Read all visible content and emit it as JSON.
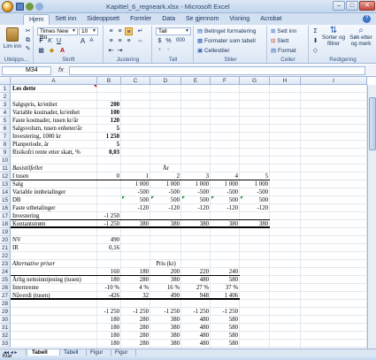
{
  "window": {
    "title": "Kapittel_6_regneark.xlsx - Microsoft Excel",
    "min": "–",
    "max": "□",
    "close": "✕"
  },
  "tabs": [
    "Hjem",
    "Sett inn",
    "Sideoppsett",
    "Formler",
    "Data",
    "Se gjennom",
    "Visning",
    "Acrobat"
  ],
  "ribbon": {
    "clipboard": {
      "paste": "Lim inn",
      "label": "Utklipps..."
    },
    "font": {
      "name": "Times New Ro",
      "size": "10",
      "bold": "F",
      "italic": "K",
      "underline": "U",
      "grow": "A",
      "shrink": "A",
      "label": "Skrift"
    },
    "alignment": {
      "label": "Justering"
    },
    "number": {
      "format": "Tall",
      "currency": "%",
      "pct": "000",
      "label": "Tall"
    },
    "styles": {
      "cond": "Betinget formatering",
      "table": "Formater som tabell",
      "cell": "Cellestiler",
      "label": "Stiler"
    },
    "cells": {
      "insert": "Sett inn",
      "delete": "Slett",
      "format": "Format",
      "label": "Celler"
    },
    "editing": {
      "sigma": "Σ",
      "sort": "Sorter og filtrer",
      "find": "Søk etter og merk",
      "label": "Redigering"
    }
  },
  "formula_bar": {
    "name_box": "M34",
    "fx": "fx",
    "value": ""
  },
  "columns": [
    "A",
    "B",
    "C",
    "D",
    "E",
    "F",
    "G",
    "H",
    "I"
  ],
  "rows": [
    {
      "n": "1",
      "cells": [
        {
          "col": "A",
          "v": "Les dette",
          "b": true
        }
      ]
    },
    {
      "n": "2",
      "cells": []
    },
    {
      "n": "3",
      "cells": [
        {
          "col": "A",
          "v": "Salgspris, kr/enhet"
        },
        {
          "col": "B",
          "v": "200",
          "b": true,
          "r": true
        }
      ]
    },
    {
      "n": "4",
      "cells": [
        {
          "col": "A",
          "v": "Variable kostnader, kr/enhet"
        },
        {
          "col": "B",
          "v": "100",
          "b": true,
          "r": true
        }
      ]
    },
    {
      "n": "5",
      "cells": [
        {
          "col": "A",
          "v": "Faste kostnader, tusen kr/år"
        },
        {
          "col": "B",
          "v": "120",
          "b": true,
          "r": true
        }
      ]
    },
    {
      "n": "6",
      "cells": [
        {
          "col": "A",
          "v": "Salgsvolum, tusen enheter/år"
        },
        {
          "col": "B",
          "v": "5",
          "b": true,
          "r": true
        }
      ]
    },
    {
      "n": "7",
      "cells": [
        {
          "col": "A",
          "v": "Investering, 1000 kr"
        },
        {
          "col": "B",
          "v": "1 250",
          "b": true,
          "r": true
        }
      ]
    },
    {
      "n": "8",
      "cells": [
        {
          "col": "A",
          "v": "Planperiode, år"
        },
        {
          "col": "B",
          "v": "5",
          "b": true,
          "r": true
        }
      ]
    },
    {
      "n": "9",
      "cells": [
        {
          "col": "A",
          "v": "Risikofri rente etter skatt, %"
        },
        {
          "col": "B",
          "v": "0,03",
          "b": true,
          "r": true
        }
      ]
    },
    {
      "n": "10",
      "cells": []
    },
    {
      "n": "11",
      "cells": [
        {
          "col": "A",
          "v": "Basistilfellet",
          "i": true
        },
        {
          "col": "D",
          "v": "År",
          "c": true
        }
      ]
    },
    {
      "n": "12",
      "cells": [
        {
          "col": "A",
          "v": "I tusen",
          "ul": true
        },
        {
          "col": "B",
          "v": "0",
          "r": true,
          "ul": true
        },
        {
          "col": "C",
          "v": "1",
          "r": true,
          "ul": true
        },
        {
          "col": "D",
          "v": "2",
          "r": true,
          "ul": true
        },
        {
          "col": "E",
          "v": "3",
          "r": true,
          "ul": true
        },
        {
          "col": "F",
          "v": "4",
          "r": true,
          "ul": true
        },
        {
          "col": "G",
          "v": "5",
          "r": true,
          "ul": true
        }
      ]
    },
    {
      "n": "13",
      "cells": [
        {
          "col": "A",
          "v": "Salg"
        },
        {
          "col": "C",
          "v": "1 000",
          "r": true
        },
        {
          "col": "D",
          "v": "1 000",
          "r": true
        },
        {
          "col": "E",
          "v": "1 000",
          "r": true
        },
        {
          "col": "F",
          "v": "1 000",
          "r": true
        },
        {
          "col": "G",
          "v": "1 000",
          "r": true
        }
      ]
    },
    {
      "n": "14",
      "cells": [
        {
          "col": "A",
          "v": "Variable innbetalinger"
        },
        {
          "col": "C",
          "v": "-500",
          "r": true
        },
        {
          "col": "D",
          "v": "-500",
          "r": true
        },
        {
          "col": "E",
          "v": "-500",
          "r": true
        },
        {
          "col": "F",
          "v": "-500",
          "r": true
        },
        {
          "col": "G",
          "v": "-500",
          "r": true
        }
      ]
    },
    {
      "n": "15",
      "cells": [
        {
          "col": "A",
          "v": "DB"
        },
        {
          "col": "C",
          "v": "500",
          "r": true
        },
        {
          "col": "D",
          "v": "500",
          "r": true
        },
        {
          "col": "E",
          "v": "500",
          "r": true
        },
        {
          "col": "F",
          "v": "500",
          "r": true
        },
        {
          "col": "G",
          "v": "500",
          "r": true
        }
      ]
    },
    {
      "n": "16",
      "cells": [
        {
          "col": "A",
          "v": "Faste utbetalinger"
        },
        {
          "col": "C",
          "v": "-120",
          "r": true
        },
        {
          "col": "D",
          "v": "-120",
          "r": true
        },
        {
          "col": "E",
          "v": "-120",
          "r": true
        },
        {
          "col": "F",
          "v": "-120",
          "r": true
        },
        {
          "col": "G",
          "v": "-120",
          "r": true
        }
      ]
    },
    {
      "n": "17",
      "cells": [
        {
          "col": "A",
          "v": "Investering",
          "ul": true
        },
        {
          "col": "B",
          "v": "-1 250",
          "r": true,
          "ul": true
        },
        {
          "col": "C",
          "v": "",
          "ul": true
        },
        {
          "col": "D",
          "v": "",
          "ul": true
        },
        {
          "col": "E",
          "v": "",
          "ul": true
        },
        {
          "col": "F",
          "v": "",
          "ul": true
        },
        {
          "col": "G",
          "v": "",
          "ul": true
        }
      ]
    },
    {
      "n": "18",
      "cells": [
        {
          "col": "A",
          "v": "Kontantstrøm",
          "dbl": true
        },
        {
          "col": "B",
          "v": "-1 250",
          "r": true,
          "dbl": true
        },
        {
          "col": "C",
          "v": "380",
          "r": true,
          "dbl": true
        },
        {
          "col": "D",
          "v": "380",
          "r": true,
          "dbl": true
        },
        {
          "col": "E",
          "v": "380",
          "r": true,
          "dbl": true
        },
        {
          "col": "F",
          "v": "380",
          "r": true,
          "dbl": true
        },
        {
          "col": "G",
          "v": "380",
          "r": true,
          "dbl": true
        }
      ]
    },
    {
      "n": "19",
      "cells": []
    },
    {
      "n": "20",
      "cells": [
        {
          "col": "A",
          "v": "NV"
        },
        {
          "col": "B",
          "v": "490",
          "r": true
        }
      ]
    },
    {
      "n": "21",
      "cells": [
        {
          "col": "A",
          "v": "IR"
        },
        {
          "col": "B",
          "v": "0,16",
          "r": true
        }
      ]
    },
    {
      "n": "22",
      "cells": []
    },
    {
      "n": "23",
      "cells": [
        {
          "col": "A",
          "v": "Alternative priser",
          "i": true
        },
        {
          "col": "D",
          "v": "Pris (kr)",
          "c": true
        }
      ]
    },
    {
      "n": "24",
      "cells": [
        {
          "col": "B",
          "v": "160",
          "r": true,
          "ul": true
        },
        {
          "col": "C",
          "v": "180",
          "r": true,
          "ul": true
        },
        {
          "col": "D",
          "v": "200",
          "r": true,
          "ul": true
        },
        {
          "col": "E",
          "v": "220",
          "r": true,
          "ul": true
        },
        {
          "col": "F",
          "v": "240",
          "r": true,
          "ul": true
        },
        {
          "col": "A",
          "v": "",
          "ul": true
        }
      ]
    },
    {
      "n": "25",
      "cells": [
        {
          "col": "A",
          "v": "Årlig nettoinntjening (tusen)"
        },
        {
          "col": "B",
          "v": "180",
          "r": true
        },
        {
          "col": "C",
          "v": "280",
          "r": true
        },
        {
          "col": "D",
          "v": "380",
          "r": true
        },
        {
          "col": "E",
          "v": "480",
          "r": true
        },
        {
          "col": "F",
          "v": "580",
          "r": true
        }
      ]
    },
    {
      "n": "26",
      "cells": [
        {
          "col": "A",
          "v": "Internrente"
        },
        {
          "col": "B",
          "v": "-10 %",
          "r": true
        },
        {
          "col": "C",
          "v": "4 %",
          "r": true
        },
        {
          "col": "D",
          "v": "16 %",
          "r": true
        },
        {
          "col": "E",
          "v": "27 %",
          "r": true
        },
        {
          "col": "F",
          "v": "37 %",
          "r": true
        }
      ]
    },
    {
      "n": "27",
      "cells": [
        {
          "col": "A",
          "v": "Nåverdi (tusen)",
          "dbl": true
        },
        {
          "col": "B",
          "v": "-426",
          "r": true,
          "dbl": true
        },
        {
          "col": "C",
          "v": "32",
          "r": true,
          "dbl": true
        },
        {
          "col": "D",
          "v": "490",
          "r": true,
          "dbl": true
        },
        {
          "col": "E",
          "v": "948",
          "r": true,
          "dbl": true
        },
        {
          "col": "F",
          "v": "1 406",
          "r": true,
          "dbl": true
        }
      ]
    },
    {
      "n": "28",
      "cells": []
    },
    {
      "n": "29",
      "cells": [
        {
          "col": "B",
          "v": "-1 250",
          "r": true
        },
        {
          "col": "C",
          "v": "-1 250",
          "r": true
        },
        {
          "col": "D",
          "v": "-1 250",
          "r": true
        },
        {
          "col": "E",
          "v": "-1 250",
          "r": true
        },
        {
          "col": "F",
          "v": "-1 250",
          "r": true
        }
      ]
    },
    {
      "n": "30",
      "cells": [
        {
          "col": "B",
          "v": "180",
          "r": true
        },
        {
          "col": "C",
          "v": "280",
          "r": true
        },
        {
          "col": "D",
          "v": "380",
          "r": true
        },
        {
          "col": "E",
          "v": "480",
          "r": true
        },
        {
          "col": "F",
          "v": "580",
          "r": true
        }
      ]
    },
    {
      "n": "31",
      "cells": [
        {
          "col": "B",
          "v": "180",
          "r": true
        },
        {
          "col": "C",
          "v": "280",
          "r": true
        },
        {
          "col": "D",
          "v": "380",
          "r": true
        },
        {
          "col": "E",
          "v": "480",
          "r": true
        },
        {
          "col": "F",
          "v": "580",
          "r": true
        }
      ]
    },
    {
      "n": "32",
      "cells": [
        {
          "col": "B",
          "v": "180",
          "r": true
        },
        {
          "col": "C",
          "v": "280",
          "r": true
        },
        {
          "col": "D",
          "v": "380",
          "r": true
        },
        {
          "col": "E",
          "v": "480",
          "r": true
        },
        {
          "col": "F",
          "v": "580",
          "r": true
        }
      ]
    },
    {
      "n": "33",
      "cells": [
        {
          "col": "B",
          "v": "180",
          "r": true
        },
        {
          "col": "C",
          "v": "280",
          "r": true
        },
        {
          "col": "D",
          "v": "380",
          "r": true
        },
        {
          "col": "E",
          "v": "480",
          "r": true
        },
        {
          "col": "F",
          "v": "580",
          "r": true
        }
      ]
    }
  ],
  "sheets": [
    "Tabell 6.2",
    "Tabell 6.3",
    "Figur 6.2",
    "Figur 6.3"
  ],
  "active_sheet": "Tabell 6.2",
  "status": {
    "ready": "Klar"
  },
  "colors": {
    "accent": "#2a5db0",
    "ribbon": "#dce7f5"
  }
}
